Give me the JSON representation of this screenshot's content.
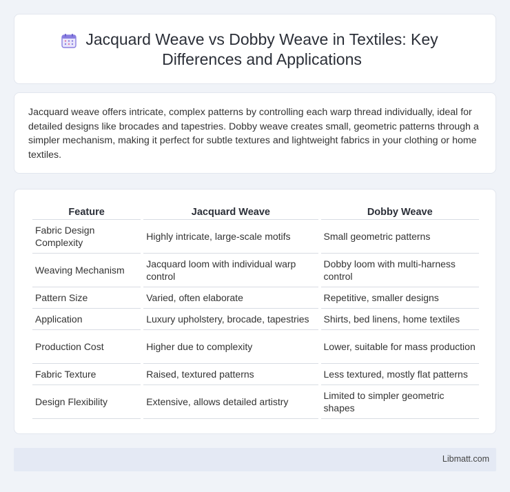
{
  "header": {
    "title": "Jacquard Weave vs Dobby Weave in Textiles: Key Differences and Applications",
    "icon": "calendar-icon"
  },
  "intro": {
    "text": "Jacquard weave offers intricate, complex patterns by controlling each warp thread individually, ideal for detailed designs like brocades and tapestries. Dobby weave creates small, geometric patterns through a simpler mechanism, making it perfect for subtle textures and lightweight fabrics in your clothing or home textiles."
  },
  "table": {
    "headers": [
      "Feature",
      "Jacquard Weave",
      "Dobby Weave"
    ],
    "rows": [
      [
        "Fabric Design Complexity",
        "Highly intricate, large-scale motifs",
        "Small geometric patterns"
      ],
      [
        "Weaving Mechanism",
        "Jacquard loom with individual warp control",
        "Dobby loom with multi-harness control"
      ],
      [
        "Pattern Size",
        "Varied, often elaborate",
        "Repetitive, smaller designs"
      ],
      [
        "Application",
        "Luxury upholstery, brocade, tapestries",
        "Shirts, bed linens, home textiles"
      ],
      [
        "Production Cost",
        "Higher due to complexity",
        "Lower, suitable for mass production"
      ],
      [
        "Fabric Texture",
        "Raised, textured patterns",
        "Less textured, mostly flat patterns"
      ],
      [
        "Design Flexibility",
        "Extensive, allows detailed artistry",
        "Limited to simpler geometric shapes"
      ]
    ]
  },
  "footer": {
    "text": "Libmatt.com"
  },
  "colors": {
    "background": "#f0f3f8",
    "card": "#ffffff",
    "footer_bg": "#e4e9f4",
    "icon_accent": "#7b6fd6"
  }
}
